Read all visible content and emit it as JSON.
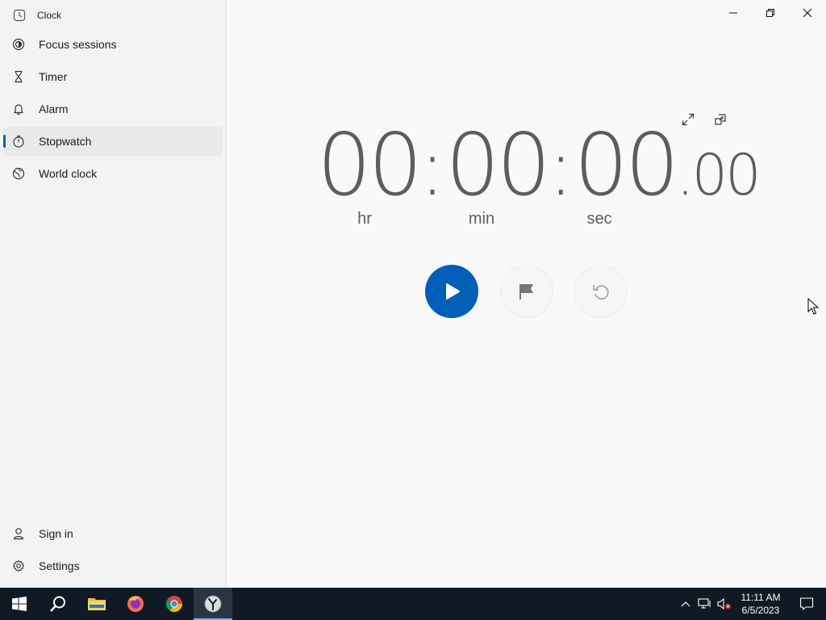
{
  "app": {
    "title": "Clock"
  },
  "sidebar": {
    "items": [
      {
        "label": "Focus sessions",
        "icon": "focus-icon"
      },
      {
        "label": "Timer",
        "icon": "hourglass-icon"
      },
      {
        "label": "Alarm",
        "icon": "bell-icon"
      },
      {
        "label": "Stopwatch",
        "icon": "stopwatch-icon",
        "active": true
      },
      {
        "label": "World clock",
        "icon": "globe-icon"
      }
    ],
    "bottom": [
      {
        "label": "Sign in",
        "icon": "person-icon"
      },
      {
        "label": "Settings",
        "icon": "gear-icon"
      }
    ]
  },
  "stopwatch": {
    "hours": "00",
    "minutes": "00",
    "seconds": "00",
    "centiseconds": "00",
    "unit_hr": "hr",
    "unit_min": "min",
    "unit_sec": "sec"
  },
  "taskbar": {
    "time": "11:11 AM",
    "date": "6/5/2023"
  },
  "colors": {
    "accent": "#005fb8",
    "taskbar_bg": "#101a24"
  }
}
